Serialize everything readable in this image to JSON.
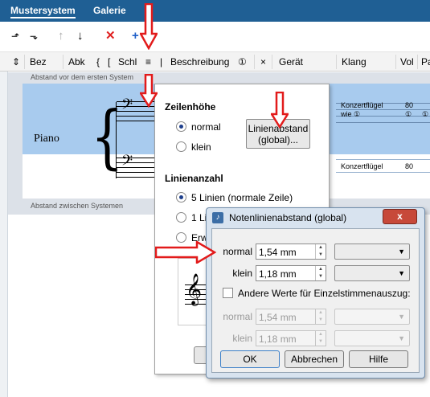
{
  "tabs": [
    {
      "label": "Mustersystem"
    },
    {
      "label": "Galerie"
    }
  ],
  "toolbar": {
    "icons": [
      "insert-staff-before-icon",
      "insert-staff-after-icon",
      "move-up-icon",
      "move-down-icon",
      "delete-icon",
      "add-icon"
    ]
  },
  "header": {
    "cols": [
      "Bez",
      "Abk",
      "{",
      "[",
      "Schl",
      "≡",
      "|",
      "Beschreibung",
      "①",
      "×",
      "Gerät",
      "Klang",
      "Vol",
      "Pa"
    ]
  },
  "rows": {
    "gap_top": "Abstand vor dem ersten System",
    "gap_between": "Abstand zwischen Systemen",
    "instrument": "Piano",
    "staff1": {
      "klang": "Konzertflügel",
      "klang2": "wie ①",
      "vol": "80",
      "vol2": "①",
      "pa2": "①"
    },
    "staff2": {
      "klang": "Konzertflügel",
      "vol": "80"
    }
  },
  "popup": {
    "zeilenhoehe_title": "Zeilenhöhe",
    "normal": "normal",
    "klein": "klein",
    "linien_btn_line1": "Linienabstand",
    "linien_btn_line2": "(global)...",
    "linienanzahl_title": "Linienanzahl",
    "five_lines": "5 Linien (normale Zeile)",
    "one_line": "1 Li",
    "erw": "Erw"
  },
  "dialog": {
    "title": "Notenlinienabstand (global)",
    "close": "x",
    "normal_label": "normal",
    "normal_value": "1,54 mm",
    "klein_label": "klein",
    "klein_value": "1,18 mm",
    "checkbox_label": "Andere Werte für Einzelstimmenauszug:",
    "normal2_label": "normal",
    "normal2_value": "1,54 mm",
    "klein2_label": "klein",
    "klein2_value": "1,18 mm",
    "ok": "OK",
    "cancel": "Abbrechen",
    "help": "Hilfe"
  },
  "colors": {
    "tabbar": "#1f5f94",
    "selection": "#a8cbee",
    "arrow": "#e21b1b"
  }
}
